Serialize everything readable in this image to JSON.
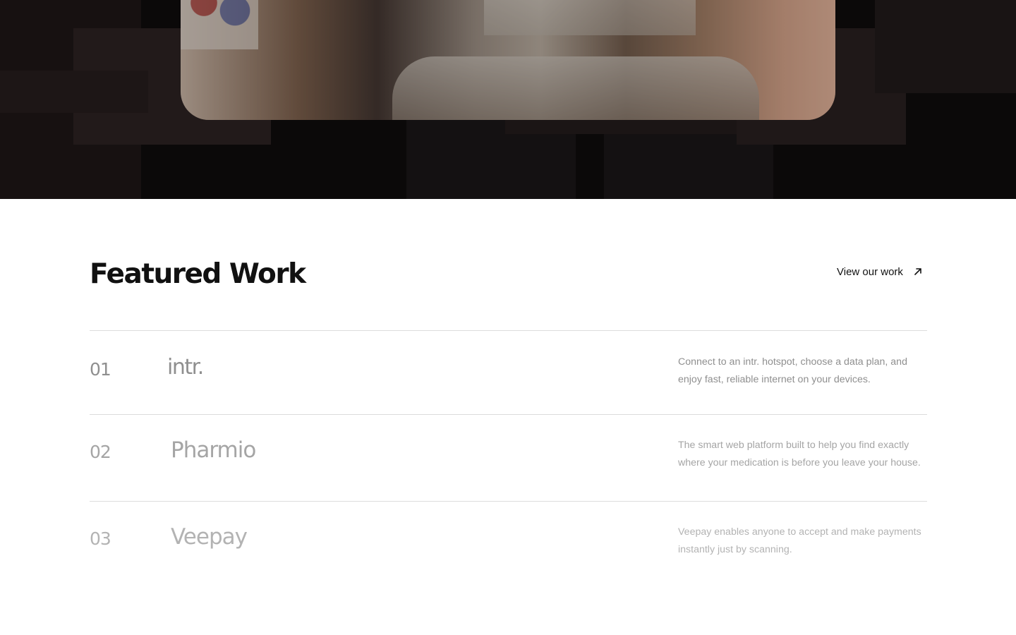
{
  "hero": {
    "image_alt": "Team meeting around a table",
    "accent_colors": [
      "#0b0909",
      "#2a2020",
      "#c49a82"
    ]
  },
  "featured": {
    "title": "Featured Work",
    "view_link_label": "View our work",
    "view_link_icon": "arrow-up-right-icon",
    "projects": [
      {
        "number": "01",
        "name": "intr.",
        "description": "Connect to an intr. hotspot, choose a data plan, and enjoy fast, reliable internet on your devices."
      },
      {
        "number": "02",
        "name": "Pharmio",
        "description": "The smart web platform built to help you find exactly where your medication is before you leave your house."
      },
      {
        "number": "03",
        "name": "Veepay",
        "description": "Veepay enables anyone to accept and make payments instantly just by scanning."
      }
    ]
  }
}
